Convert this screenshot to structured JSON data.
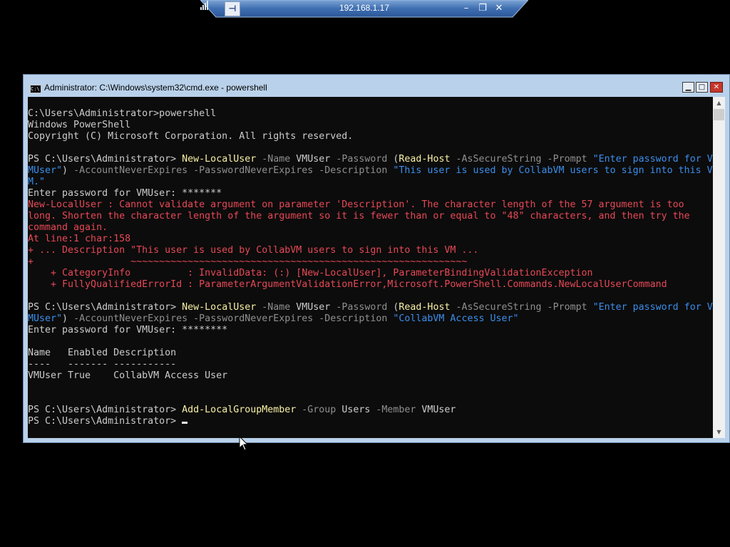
{
  "remote_bar": {
    "pin_label": "⊣",
    "address": "192.168.1.17",
    "minimize_glyph": "–",
    "restore_glyph": "❐",
    "close_glyph": "✕",
    "signal_icon": "signal-bars-icon"
  },
  "window": {
    "title": "Administrator: C:\\Windows\\system32\\cmd.exe - powershell",
    "icon_text": "C:\\",
    "minimize_glyph": "▁",
    "maximize_glyph": "□",
    "close_glyph": "✕"
  },
  "colors": {
    "console_bg": "#0c0c0c",
    "default_text": "#cccccc",
    "command": "#f9f1a5",
    "parameter": "#8f8f8f",
    "string": "#3b8eea",
    "error": "#e74856"
  },
  "console": {
    "lines": [
      [
        {
          "t": "C:\\Users\\Administrator>powershell",
          "c": "default"
        }
      ],
      [
        {
          "t": "Windows PowerShell",
          "c": "default"
        }
      ],
      [
        {
          "t": "Copyright (C) Microsoft Corporation. All rights reserved.",
          "c": "default"
        }
      ],
      [
        {
          "t": "",
          "c": "default"
        }
      ],
      [
        {
          "t": "PS C:\\Users\\Administrator> ",
          "c": "default"
        },
        {
          "t": "New-LocalUser",
          "c": "cmd"
        },
        {
          "t": " -Name ",
          "c": "param"
        },
        {
          "t": "VMUser",
          "c": "default"
        },
        {
          "t": " -Password ",
          "c": "param"
        },
        {
          "t": "(",
          "c": "default"
        },
        {
          "t": "Read-Host",
          "c": "cmd"
        },
        {
          "t": " -AsSecureString -Prompt ",
          "c": "param"
        },
        {
          "t": "\"Enter password for V",
          "c": "str"
        }
      ],
      [
        {
          "t": "MUser\"",
          "c": "str"
        },
        {
          "t": ") ",
          "c": "default"
        },
        {
          "t": "-AccountNeverExpires -PasswordNeverExpires -Description ",
          "c": "param"
        },
        {
          "t": "\"This user is used by CollabVM users to sign into this V",
          "c": "str"
        }
      ],
      [
        {
          "t": "M.\"",
          "c": "str"
        }
      ],
      [
        {
          "t": "Enter password for VMUser: *******",
          "c": "default"
        }
      ],
      [
        {
          "t": "New-LocalUser : Cannot validate argument on parameter 'Description'. The character length of the 57 argument is too",
          "c": "err"
        }
      ],
      [
        {
          "t": "long. Shorten the character length of the argument so it is fewer than or equal to \"48\" characters, and then try the",
          "c": "err"
        }
      ],
      [
        {
          "t": "command again.",
          "c": "err"
        }
      ],
      [
        {
          "t": "At line:1 char:158",
          "c": "err"
        }
      ],
      [
        {
          "t": "+ ... Description \"This user is used by CollabVM users to sign into this VM ...",
          "c": "err"
        }
      ],
      [
        {
          "t": "+                 ~~~~~~~~~~~~~~~~~~~~~~~~~~~~~~~~~~~~~~~~~~~~~~~~~~~~~~~~~~~",
          "c": "err"
        }
      ],
      [
        {
          "t": "    + CategoryInfo          : InvalidData: (:) [New-LocalUser], ParameterBindingValidationException",
          "c": "err"
        }
      ],
      [
        {
          "t": "    + FullyQualifiedErrorId : ParameterArgumentValidationError,Microsoft.PowerShell.Commands.NewLocalUserCommand",
          "c": "err"
        }
      ],
      [
        {
          "t": "",
          "c": "default"
        }
      ],
      [
        {
          "t": "PS C:\\Users\\Administrator> ",
          "c": "default"
        },
        {
          "t": "New-LocalUser",
          "c": "cmd"
        },
        {
          "t": " -Name ",
          "c": "param"
        },
        {
          "t": "VMUser",
          "c": "default"
        },
        {
          "t": " -Password ",
          "c": "param"
        },
        {
          "t": "(",
          "c": "default"
        },
        {
          "t": "Read-Host",
          "c": "cmd"
        },
        {
          "t": " -AsSecureString -Prompt ",
          "c": "param"
        },
        {
          "t": "\"Enter password for V",
          "c": "str"
        }
      ],
      [
        {
          "t": "MUser\"",
          "c": "str"
        },
        {
          "t": ") ",
          "c": "default"
        },
        {
          "t": "-AccountNeverExpires -PasswordNeverExpires -Description ",
          "c": "param"
        },
        {
          "t": "\"CollabVM Access User\"",
          "c": "str"
        }
      ],
      [
        {
          "t": "Enter password for VMUser: ********",
          "c": "default"
        }
      ],
      [
        {
          "t": "",
          "c": "default"
        }
      ],
      [
        {
          "t": "Name   Enabled Description",
          "c": "default"
        }
      ],
      [
        {
          "t": "----   ------- -----------",
          "c": "default"
        }
      ],
      [
        {
          "t": "VMUser True    CollabVM Access User",
          "c": "default"
        }
      ],
      [
        {
          "t": "",
          "c": "default"
        }
      ],
      [
        {
          "t": "",
          "c": "default"
        }
      ],
      [
        {
          "t": "PS C:\\Users\\Administrator> ",
          "c": "default"
        },
        {
          "t": "Add-LocalGroupMember",
          "c": "cmd"
        },
        {
          "t": " -Group ",
          "c": "param"
        },
        {
          "t": "Users",
          "c": "default"
        },
        {
          "t": " -Member ",
          "c": "param"
        },
        {
          "t": "VMUser",
          "c": "default"
        }
      ],
      [
        {
          "t": "PS C:\\Users\\Administrator> ",
          "c": "default"
        }
      ]
    ]
  }
}
